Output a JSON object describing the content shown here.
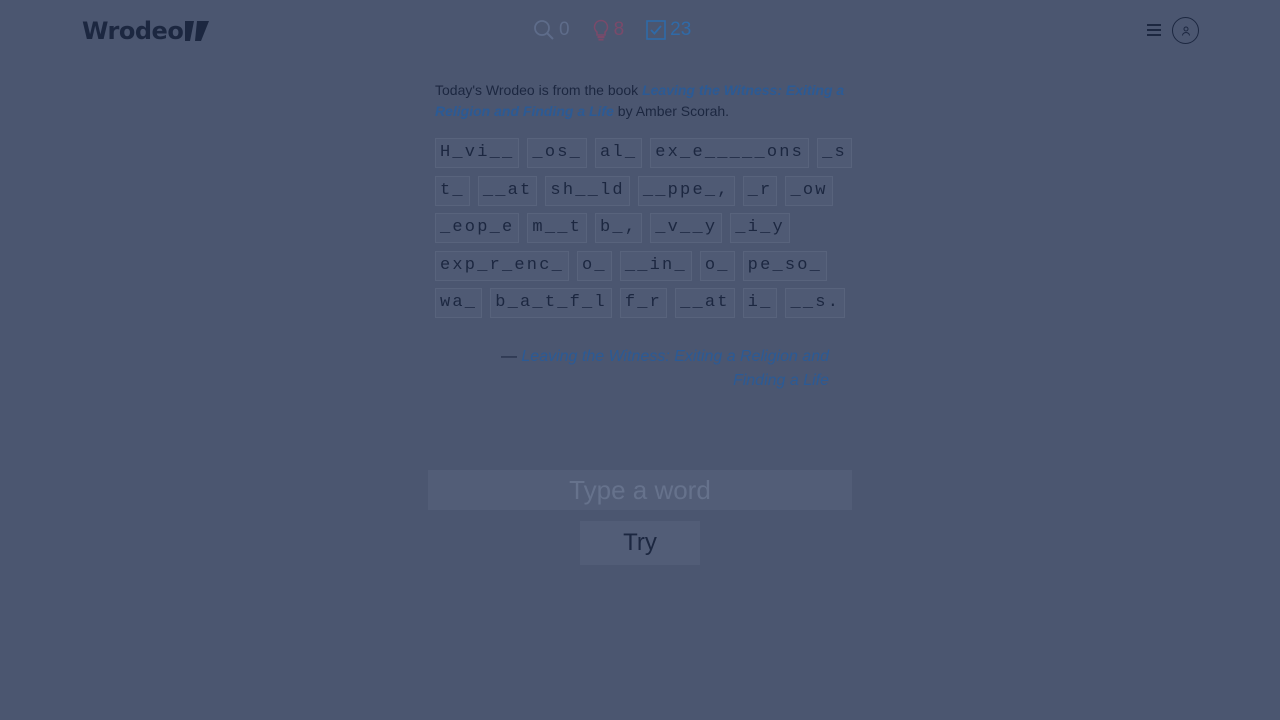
{
  "header": {
    "logo_text": "Wrodeo",
    "stats": {
      "search_count": "0",
      "hint_count": "8",
      "solved_count": "23"
    }
  },
  "intro": {
    "prefix": "Today's Wrodeo is from the book ",
    "book_title": "Leaving the Witness: Exiting a Religion and Finding a Life",
    "by": " by ",
    "author": "Amber Scorah",
    "suffix": "."
  },
  "puzzle": {
    "rows": [
      [
        "H_vi__",
        "_os_",
        "al_",
        "ex_e_____ons",
        "_s"
      ],
      [
        "t_",
        "__at",
        "sh__ld",
        "__ppe_,",
        "_r",
        "_ow"
      ],
      [
        "_eop_e",
        "m__t",
        "b_,",
        "_v__y",
        "_i_y"
      ],
      [
        "exp_r_enc_",
        "o_",
        "__in_",
        "o_",
        "pe_so_"
      ],
      [
        "wa_",
        "b_a_t_f_l",
        "f_r",
        "__at",
        "i_",
        "__s."
      ]
    ]
  },
  "attribution": {
    "dash": "— ",
    "source": "Leaving the Witness: Exiting a Religion and Finding a Life"
  },
  "input": {
    "placeholder": "Type a word",
    "value": ""
  },
  "try_button": {
    "label": "Try"
  },
  "colors": {
    "overlay_background": "#4b5670",
    "text_dark": "#1c2740",
    "link_blue": "#2b5a95"
  }
}
